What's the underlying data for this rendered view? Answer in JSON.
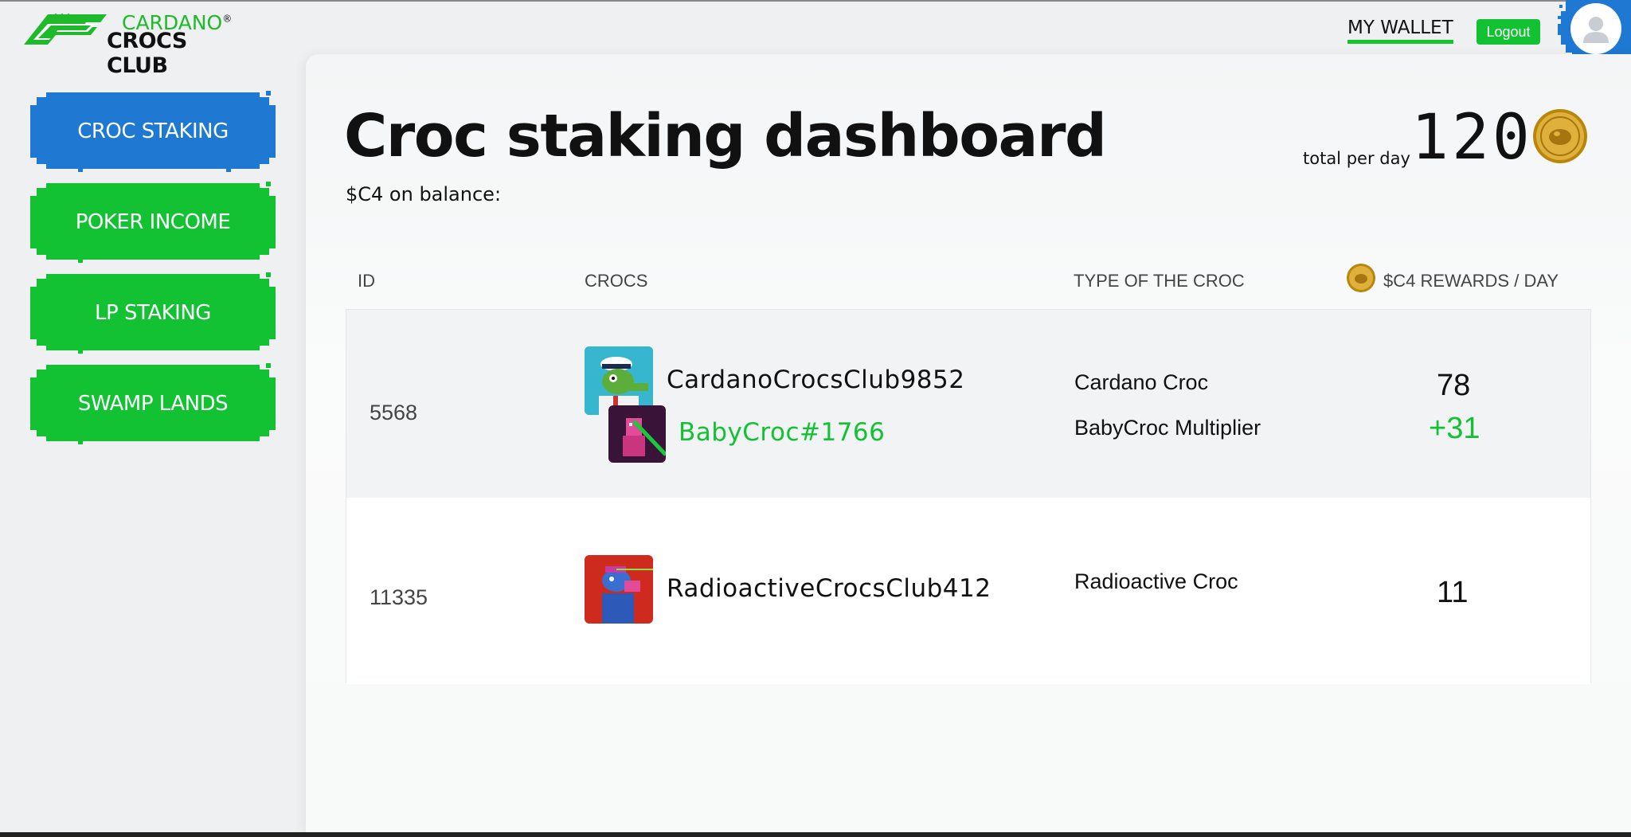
{
  "header": {
    "logo_line1": "CARDANO",
    "logo_reg": "®",
    "logo_line2": "CROCS CLUB",
    "wallet_link": "MY WALLET",
    "logout_label": "Logout"
  },
  "sidebar": {
    "items": [
      {
        "label": "CROC STAKING",
        "active": true
      },
      {
        "label": "POKER INCOME",
        "active": false
      },
      {
        "label": "LP STAKING",
        "active": false
      },
      {
        "label": "SWAMP LANDS",
        "active": false
      }
    ]
  },
  "main": {
    "title": "Croc staking dashboard",
    "balance_label": "$C4 on balance:",
    "total_label": "total per day",
    "total_value": "120",
    "table": {
      "headers": [
        "ID",
        "CROCS",
        "TYPE OF THE CROC",
        "$C4 REWARDS / DAY"
      ],
      "rows": [
        {
          "id": "5568",
          "croc_name": "CardanoCrocsClub9852",
          "baby_name": "BabyCroc#1766",
          "type": "Cardano Croc",
          "type2": "BabyCroc Multiplier",
          "reward": "78",
          "reward_bonus": "+31"
        },
        {
          "id": "11335",
          "croc_name": "RadioactiveCrocsClub412",
          "type": "Radioactive Croc",
          "reward": "11"
        }
      ]
    }
  },
  "colors": {
    "active_nav": "#1f78d1",
    "nav": "#12c233",
    "accent_green": "#12c233",
    "coin_gold": "#d4a017"
  },
  "icons": [
    "croc-logo-icon",
    "user-avatar-icon",
    "c4-coin-icon"
  ]
}
